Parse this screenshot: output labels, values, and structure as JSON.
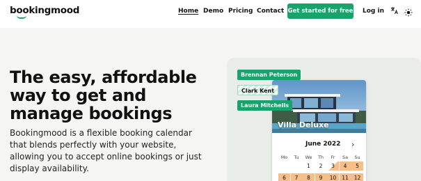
{
  "header": {
    "logo": "bookingmood",
    "nav": [
      "Home",
      "Demo",
      "Pricing",
      "Contact"
    ],
    "cta_label": "Get started for free",
    "login_label": "Log in",
    "translate_icon": "translate-icon",
    "theme_icon": "sun-icon"
  },
  "hero": {
    "headline": "The easy, affordable way to get and manage bookings",
    "subtext": "Bookingmood is a flexible booking calendar that blends perfectly with your website, allowing you to accept online bookings or just display availability."
  },
  "illustration": {
    "tags": [
      "Brennan Peterson",
      "Clark Kent",
      "Laura Mitchells"
    ],
    "villa_title": "Villa Deluxe",
    "month": "June 2022",
    "weekdays": [
      "Mo",
      "Tu",
      "We",
      "Th",
      "Fr",
      "Sa",
      "Su"
    ],
    "week1": [
      "",
      "",
      "1",
      "2",
      "3",
      "4",
      "5"
    ],
    "week2": [
      "6",
      "7",
      "8",
      "9",
      "10",
      "11",
      "12"
    ]
  },
  "colors": {
    "accent": "#17a36b",
    "booked": "#f6bf8a"
  }
}
